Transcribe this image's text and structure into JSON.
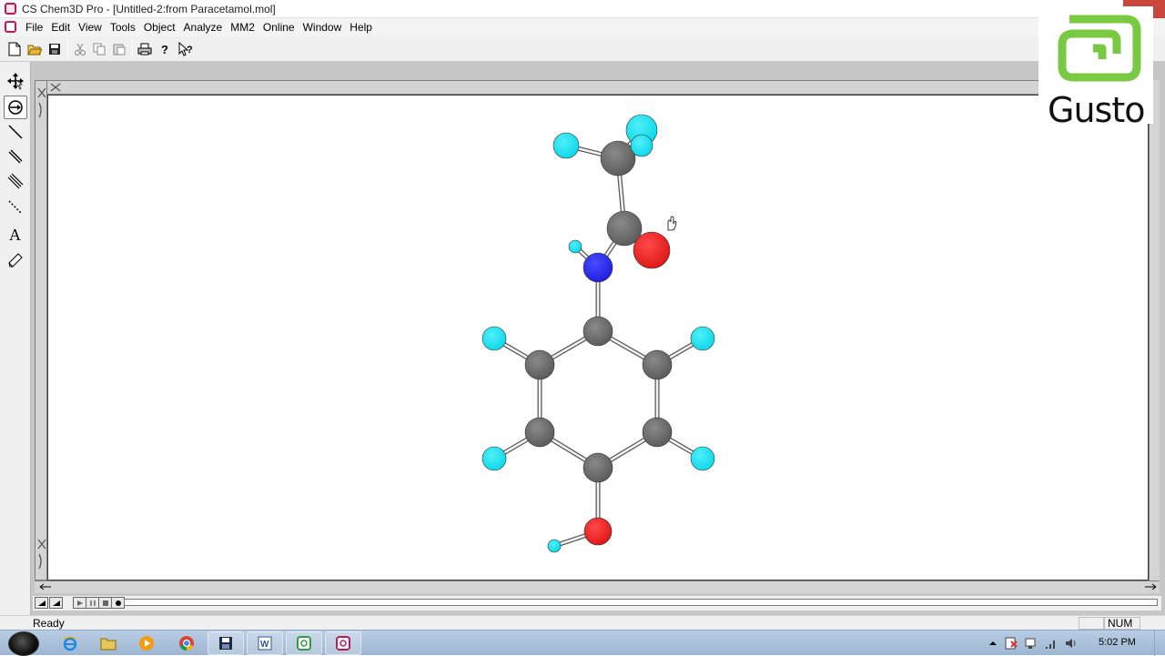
{
  "window": {
    "title": "CS Chem3D Pro - [Untitled-2:from Paracetamol.mol]",
    "app_icon": "chem3d-app-icon"
  },
  "menubar": {
    "items": [
      "File",
      "Edit",
      "View",
      "Tools",
      "Object",
      "Analyze",
      "MM2",
      "Online",
      "Window",
      "Help"
    ]
  },
  "toolbar": {
    "buttons": [
      "new-icon",
      "open-icon",
      "save-icon",
      "cut-icon",
      "copy-icon",
      "paste-icon",
      "print-icon",
      "help-icon",
      "context-help-icon"
    ]
  },
  "left_tools": [
    "move-tool-icon",
    "rotate-tool-icon",
    "single-bond-icon",
    "double-bond-icon",
    "triple-bond-icon",
    "dummy-bond-icon",
    "text-tool-icon",
    "eraser-icon"
  ],
  "watermark": {
    "text": "Gusto",
    "color": "#7ac943"
  },
  "molecule": {
    "colors": {
      "carbon": "#6b6b6b",
      "hydrogen": "#17e3f0",
      "oxygen": "#ee2222",
      "nitrogen": "#2a2ee8"
    }
  },
  "movie_controls": [
    "movie-start-icon",
    "movie-end-icon",
    "play-icon",
    "pause-icon",
    "stop-icon",
    "record-icon"
  ],
  "status": {
    "text": "Ready",
    "num": "NUM"
  },
  "taskbar": {
    "apps": [
      "internet-explorer-icon",
      "file-explorer-icon",
      "media-player-icon",
      "chrome-icon",
      "save-disk-icon",
      "word-icon",
      "chemdraw-icon",
      "chem3d-icon"
    ],
    "tray_icons": [
      "tray-up-arrow-icon",
      "action-center-icon",
      "network-icon",
      "signal-icon",
      "volume-icon"
    ],
    "clock": "5:02 PM"
  }
}
